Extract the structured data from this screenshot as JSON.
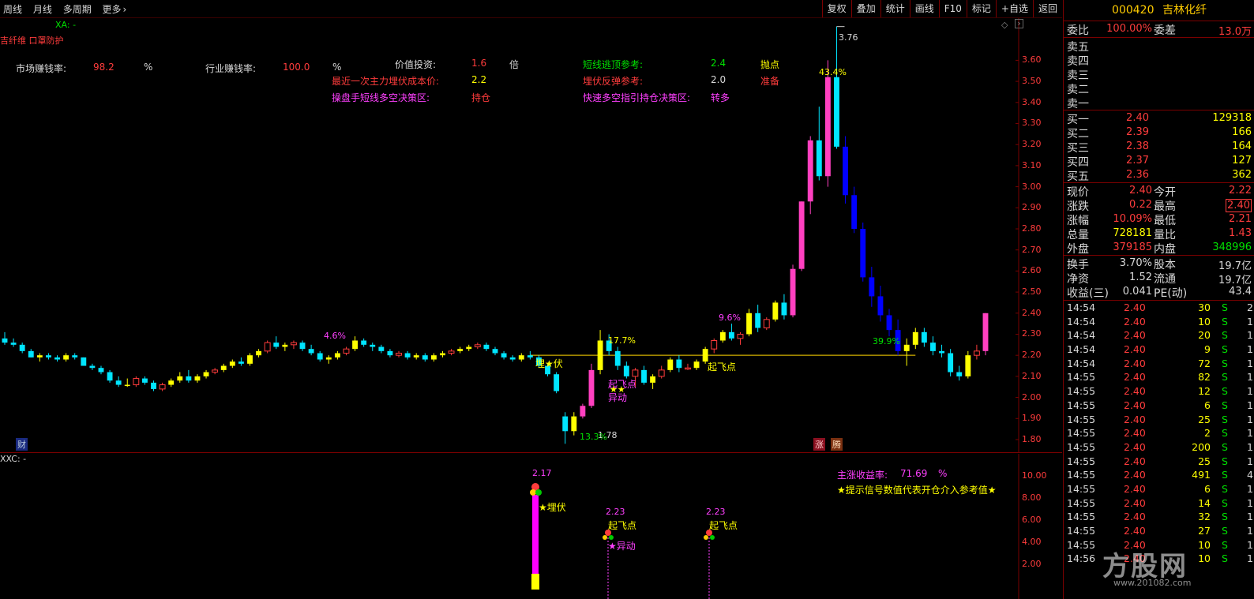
{
  "toolbar": {
    "left": [
      "周线",
      "月线",
      "多周期",
      "更多"
    ],
    "more_arrow": "›",
    "right": [
      "复权",
      "叠加",
      "统计",
      "画线",
      "F10",
      "标记",
      "+自选",
      "返回"
    ]
  },
  "main": {
    "xa_label": "XA: -",
    "indicator_title": "吉纤维 口罩防护",
    "stats": {
      "market_label": "市场赚钱率:",
      "market_value": "98.2",
      "market_unit": "%",
      "industry_label": "行业赚钱率:",
      "industry_value": "100.0",
      "industry_unit": "%",
      "value_label": "价值投资:",
      "value_value": "1.6",
      "value_unit": "倍",
      "cost_label": "最近一次主力埋伏成本价:",
      "cost_value": "2.2",
      "trader_label": "操盘手短线多空决策区:",
      "trader_value": "持仓",
      "escape_label": "短线逃顶参考:",
      "escape_value": "2.4",
      "escape_signal": "抛点",
      "rebound_label": "埋伏反弹参考:",
      "rebound_value": "2.0",
      "rebound_signal": "准备",
      "fast_label": "快速多空指引持仓决策区:",
      "fast_value": "转多"
    },
    "annotations": {
      "high": "3.76",
      "low": "1.78",
      "low_pct": "13.3%",
      "p_4_6": "4.6%",
      "p_17_7": "17.7%",
      "p_9_6": "9.6%",
      "p_43_4": "43.4%",
      "p_39_9": "39.9%",
      "maifu": "埋★伏",
      "qifei1": "起飞点",
      "qifei2": "起飞点",
      "stars": "★★",
      "yidong": "异动",
      "cai": "财",
      "zhang": "涨",
      "teng": "腾"
    },
    "y_axis": [
      "3.60",
      "3.50",
      "3.40",
      "3.30",
      "3.20",
      "3.10",
      "3.00",
      "2.90",
      "2.80",
      "2.70",
      "2.60",
      "2.50",
      "2.40",
      "2.30",
      "2.20",
      "2.10",
      "2.00",
      "1.90",
      "1.80"
    ],
    "chart_data": {
      "type": "candlestick",
      "ohlc": [
        [
          2.28,
          2.31,
          2.25,
          2.26
        ],
        [
          2.26,
          2.28,
          2.24,
          2.25
        ],
        [
          2.25,
          2.26,
          2.21,
          2.22
        ],
        [
          2.22,
          2.23,
          2.19,
          2.19
        ],
        [
          2.19,
          2.21,
          2.17,
          2.2
        ],
        [
          2.2,
          2.21,
          2.18,
          2.19
        ],
        [
          2.19,
          2.2,
          2.17,
          2.18
        ],
        [
          2.18,
          2.21,
          2.17,
          2.2
        ],
        [
          2.2,
          2.21,
          2.18,
          2.19
        ],
        [
          2.19,
          2.19,
          2.15,
          2.15
        ],
        [
          2.15,
          2.16,
          2.13,
          2.14
        ],
        [
          2.14,
          2.15,
          2.11,
          2.12
        ],
        [
          2.12,
          2.13,
          2.07,
          2.08
        ],
        [
          2.08,
          2.1,
          2.05,
          2.06
        ],
        [
          2.06,
          2.09,
          2.05,
          2.06
        ],
        [
          2.06,
          2.1,
          2.05,
          2.09
        ],
        [
          2.09,
          2.1,
          2.06,
          2.07
        ],
        [
          2.07,
          2.08,
          2.03,
          2.04
        ],
        [
          2.04,
          2.07,
          2.03,
          2.06
        ],
        [
          2.06,
          2.09,
          2.05,
          2.08
        ],
        [
          2.08,
          2.12,
          2.07,
          2.1
        ],
        [
          2.1,
          2.13,
          2.07,
          2.08
        ],
        [
          2.08,
          2.11,
          2.07,
          2.1
        ],
        [
          2.1,
          2.13,
          2.09,
          2.12
        ],
        [
          2.12,
          2.14,
          2.11,
          2.13
        ],
        [
          2.13,
          2.16,
          2.12,
          2.15
        ],
        [
          2.15,
          2.18,
          2.14,
          2.17
        ],
        [
          2.17,
          2.19,
          2.15,
          2.16
        ],
        [
          2.16,
          2.21,
          2.15,
          2.2
        ],
        [
          2.2,
          2.23,
          2.19,
          2.22
        ],
        [
          2.22,
          2.27,
          2.21,
          2.26
        ],
        [
          2.26,
          2.29,
          2.23,
          2.24
        ],
        [
          2.24,
          2.26,
          2.22,
          2.25
        ],
        [
          2.25,
          2.27,
          2.23,
          2.26
        ],
        [
          2.26,
          2.27,
          2.22,
          2.23
        ],
        [
          2.23,
          2.25,
          2.2,
          2.21
        ],
        [
          2.21,
          2.22,
          2.17,
          2.18
        ],
        [
          2.18,
          2.2,
          2.16,
          2.19
        ],
        [
          2.19,
          2.22,
          2.18,
          2.21
        ],
        [
          2.21,
          2.24,
          2.2,
          2.23
        ],
        [
          2.23,
          2.29,
          2.22,
          2.27
        ],
        [
          2.27,
          2.28,
          2.24,
          2.25
        ],
        [
          2.25,
          2.26,
          2.22,
          2.24
        ],
        [
          2.24,
          2.25,
          2.21,
          2.22
        ],
        [
          2.22,
          2.23,
          2.19,
          2.2
        ],
        [
          2.2,
          2.22,
          2.19,
          2.21
        ],
        [
          2.21,
          2.22,
          2.18,
          2.19
        ],
        [
          2.19,
          2.21,
          2.18,
          2.2
        ],
        [
          2.2,
          2.21,
          2.17,
          2.18
        ],
        [
          2.18,
          2.21,
          2.17,
          2.2
        ],
        [
          2.2,
          2.22,
          2.19,
          2.21
        ],
        [
          2.21,
          2.23,
          2.2,
          2.22
        ],
        [
          2.22,
          2.24,
          2.21,
          2.23
        ],
        [
          2.23,
          2.25,
          2.22,
          2.24
        ],
        [
          2.24,
          2.26,
          2.23,
          2.25
        ],
        [
          2.25,
          2.26,
          2.22,
          2.23
        ],
        [
          2.23,
          2.24,
          2.2,
          2.21
        ],
        [
          2.21,
          2.22,
          2.18,
          2.19
        ],
        [
          2.19,
          2.2,
          2.17,
          2.18
        ],
        [
          2.18,
          2.21,
          2.17,
          2.2
        ],
        [
          2.2,
          2.22,
          2.18,
          2.19
        ],
        [
          2.19,
          2.2,
          2.14,
          2.15
        ],
        [
          2.15,
          2.16,
          2.1,
          2.11
        ],
        [
          2.11,
          2.12,
          2.02,
          2.03
        ],
        [
          1.91,
          1.93,
          1.78,
          1.84
        ],
        [
          1.84,
          1.93,
          1.82,
          1.91
        ],
        [
          1.91,
          1.97,
          1.9,
          1.96
        ],
        [
          1.96,
          2.16,
          1.95,
          2.13
        ],
        [
          2.13,
          2.32,
          2.11,
          2.27
        ],
        [
          2.27,
          2.3,
          2.2,
          2.22
        ],
        [
          2.22,
          2.24,
          2.13,
          2.15
        ],
        [
          2.15,
          2.17,
          2.09,
          2.1
        ],
        [
          2.1,
          2.14,
          2.05,
          2.13
        ],
        [
          2.13,
          2.15,
          2.06,
          2.07
        ],
        [
          2.07,
          2.11,
          2.04,
          2.1
        ],
        [
          2.1,
          2.15,
          2.09,
          2.13
        ],
        [
          2.13,
          2.19,
          2.12,
          2.18
        ],
        [
          2.18,
          2.2,
          2.12,
          2.14
        ],
        [
          2.14,
          2.16,
          2.13,
          2.14
        ],
        [
          2.14,
          2.18,
          2.13,
          2.17
        ],
        [
          2.17,
          2.24,
          2.16,
          2.23
        ],
        [
          2.23,
          2.28,
          2.21,
          2.27
        ],
        [
          2.27,
          2.32,
          2.26,
          2.31
        ],
        [
          2.31,
          2.35,
          2.27,
          2.28
        ],
        [
          2.28,
          2.31,
          2.25,
          2.3
        ],
        [
          2.3,
          2.42,
          2.29,
          2.4
        ],
        [
          2.4,
          2.44,
          2.31,
          2.33
        ],
        [
          2.33,
          2.38,
          2.32,
          2.37
        ],
        [
          2.37,
          2.46,
          2.36,
          2.45
        ],
        [
          2.45,
          2.49,
          2.37,
          2.39
        ],
        [
          2.39,
          2.63,
          2.38,
          2.61
        ],
        [
          2.61,
          2.93,
          2.6,
          2.93
        ],
        [
          2.93,
          3.24,
          2.87,
          3.22
        ],
        [
          3.22,
          3.38,
          3.03,
          3.05
        ],
        [
          3.05,
          3.6,
          3.0,
          3.52
        ],
        [
          3.52,
          3.76,
          3.18,
          3.19
        ],
        [
          3.19,
          3.24,
          2.92,
          2.96
        ],
        [
          2.96,
          3.0,
          2.78,
          2.8
        ],
        [
          2.8,
          2.83,
          2.55,
          2.57
        ],
        [
          2.57,
          2.62,
          2.43,
          2.48
        ],
        [
          2.48,
          2.53,
          2.36,
          2.39
        ],
        [
          2.39,
          2.42,
          2.29,
          2.32
        ],
        [
          2.32,
          2.37,
          2.2,
          2.22
        ],
        [
          2.22,
          2.28,
          2.15,
          2.25
        ],
        [
          2.25,
          2.33,
          2.23,
          2.31
        ],
        [
          2.31,
          2.33,
          2.24,
          2.26
        ],
        [
          2.26,
          2.29,
          2.2,
          2.22
        ],
        [
          2.22,
          2.25,
          2.19,
          2.21
        ],
        [
          2.21,
          2.23,
          2.1,
          2.12
        ],
        [
          2.12,
          2.15,
          2.08,
          2.1
        ],
        [
          2.1,
          2.22,
          2.09,
          2.2
        ],
        [
          2.2,
          2.25,
          2.18,
          2.22
        ],
        [
          2.22,
          2.4,
          2.2,
          2.4
        ]
      ],
      "ylim": [
        1.74,
        3.8
      ]
    }
  },
  "sub": {
    "label": "XXC: -",
    "y_axis": [
      "10.00",
      "8.00",
      "6.00",
      "4.00",
      "2.00"
    ],
    "income_label": "主涨收益率:",
    "income_value": "71.69",
    "income_unit": "%",
    "hint": "★提示信号数值代表开仓介入参考值★",
    "signals": [
      {
        "value": "2.17",
        "name": "★埋伏"
      },
      {
        "value": "2.23",
        "name": "起飞点",
        "extra": "★异动"
      },
      {
        "value": "2.23",
        "name": "起飞点"
      }
    ]
  },
  "panel": {
    "code": "000420",
    "name": "吉林化纤",
    "weibi_label": "委比",
    "weibi": "100.00%",
    "weicha_label": "委差",
    "weicha": "13.0万",
    "asks": [
      {
        "label": "卖五",
        "price": "",
        "vol": ""
      },
      {
        "label": "卖四",
        "price": "",
        "vol": ""
      },
      {
        "label": "卖三",
        "price": "",
        "vol": ""
      },
      {
        "label": "卖二",
        "price": "",
        "vol": ""
      },
      {
        "label": "卖一",
        "price": "",
        "vol": ""
      }
    ],
    "bids": [
      {
        "label": "买一",
        "price": "2.40",
        "vol": "129318"
      },
      {
        "label": "买二",
        "price": "2.39",
        "vol": "166"
      },
      {
        "label": "买三",
        "price": "2.38",
        "vol": "164"
      },
      {
        "label": "买四",
        "price": "2.37",
        "vol": "127"
      },
      {
        "label": "买五",
        "price": "2.36",
        "vol": "362"
      }
    ],
    "quote": [
      {
        "l1": "现价",
        "v1": "2.40",
        "l2": "今开",
        "v2": "2.22"
      },
      {
        "l1": "涨跌",
        "v1": "0.22",
        "l2": "最高",
        "v2": "2.40"
      },
      {
        "l1": "涨幅",
        "v1": "10.09%",
        "l2": "最低",
        "v2": "2.21"
      },
      {
        "l1": "总量",
        "v1": "728181",
        "l2": "量比",
        "v2": "1.43"
      },
      {
        "l1": "外盘",
        "v1": "379185",
        "l2": "内盘",
        "v2": "348996"
      }
    ],
    "fund": [
      {
        "l1": "换手",
        "v1": "3.70%",
        "l2": "股本",
        "v2": "19.7亿"
      },
      {
        "l1": "净资",
        "v1": "1.52",
        "l2": "流通",
        "v2": "19.7亿"
      },
      {
        "l1": "收益(三)",
        "v1": "0.041",
        "l2": "PE(动)",
        "v2": "43.4"
      }
    ],
    "ticks": [
      {
        "t": "14:54",
        "p": "2.40",
        "v": "30",
        "s": "S",
        "n": "2"
      },
      {
        "t": "14:54",
        "p": "2.40",
        "v": "10",
        "s": "S",
        "n": "1"
      },
      {
        "t": "14:54",
        "p": "2.40",
        "v": "20",
        "s": "S",
        "n": "1"
      },
      {
        "t": "14:54",
        "p": "2.40",
        "v": "9",
        "s": "S",
        "n": "1"
      },
      {
        "t": "14:54",
        "p": "2.40",
        "v": "72",
        "s": "S",
        "n": "1"
      },
      {
        "t": "14:55",
        "p": "2.40",
        "v": "82",
        "s": "S",
        "n": "1"
      },
      {
        "t": "14:55",
        "p": "2.40",
        "v": "12",
        "s": "S",
        "n": "1"
      },
      {
        "t": "14:55",
        "p": "2.40",
        "v": "6",
        "s": "S",
        "n": "1"
      },
      {
        "t": "14:55",
        "p": "2.40",
        "v": "25",
        "s": "S",
        "n": "1"
      },
      {
        "t": "14:55",
        "p": "2.40",
        "v": "2",
        "s": "S",
        "n": "1"
      },
      {
        "t": "14:55",
        "p": "2.40",
        "v": "200",
        "s": "S",
        "n": "1"
      },
      {
        "t": "14:55",
        "p": "2.40",
        "v": "25",
        "s": "S",
        "n": "1"
      },
      {
        "t": "14:55",
        "p": "2.40",
        "v": "491",
        "s": "S",
        "n": "4"
      },
      {
        "t": "14:55",
        "p": "2.40",
        "v": "6",
        "s": "S",
        "n": "1"
      },
      {
        "t": "14:55",
        "p": "2.40",
        "v": "14",
        "s": "S",
        "n": "1"
      },
      {
        "t": "14:55",
        "p": "2.40",
        "v": "32",
        "s": "S",
        "n": "1"
      },
      {
        "t": "14:55",
        "p": "2.40",
        "v": "27",
        "s": "S",
        "n": "1"
      },
      {
        "t": "14:55",
        "p": "2.40",
        "v": "10",
        "s": "S",
        "n": "1"
      },
      {
        "t": "14:56",
        "p": "2.40",
        "v": "10",
        "s": "S",
        "n": "1"
      }
    ]
  },
  "watermark": {
    "text": "方股网",
    "url": "www.201082.com"
  }
}
